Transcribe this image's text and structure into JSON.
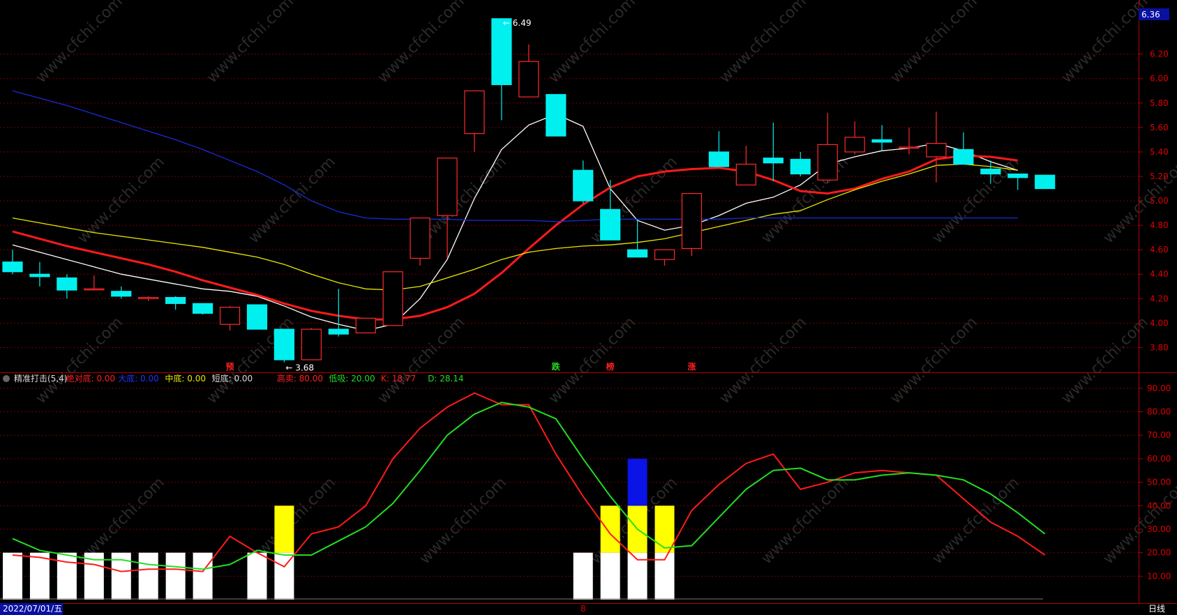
{
  "chart_data": [
    {
      "type": "candlestick",
      "name": "main",
      "ylim": [
        3.62,
        6.62
      ],
      "yticks": [
        "6.20",
        "6.00",
        "5.80",
        "5.60",
        "5.40",
        "5.20",
        "5.00",
        "4.80",
        "4.60",
        "4.40",
        "4.20",
        "4.00",
        "3.80"
      ],
      "top_value_label": "6.36",
      "max_marker": "6.49",
      "min_marker": "3.68",
      "candles": [
        {
          "o": 4.5,
          "h": 4.6,
          "l": 4.4,
          "c": 4.42
        },
        {
          "o": 4.4,
          "h": 4.5,
          "l": 4.3,
          "c": 4.38
        },
        {
          "o": 4.37,
          "h": 4.4,
          "l": 4.2,
          "c": 4.27
        },
        {
          "o": 4.28,
          "h": 4.39,
          "l": 4.27,
          "c": 4.28
        },
        {
          "o": 4.26,
          "h": 4.3,
          "l": 4.2,
          "c": 4.22
        },
        {
          "o": 4.2,
          "h": 4.22,
          "l": 4.18,
          "c": 4.21
        },
        {
          "o": 4.21,
          "h": 4.22,
          "l": 4.11,
          "c": 4.16
        },
        {
          "o": 4.16,
          "h": 4.16,
          "l": 4.07,
          "c": 4.08
        },
        {
          "o": 3.99,
          "h": 4.14,
          "l": 3.94,
          "c": 4.13
        },
        {
          "o": 4.15,
          "h": 4.15,
          "l": 3.95,
          "c": 3.95
        },
        {
          "o": 3.95,
          "h": 3.95,
          "l": 3.68,
          "c": 3.7
        },
        {
          "o": 3.7,
          "h": 3.96,
          "l": 3.7,
          "c": 3.95
        },
        {
          "o": 3.95,
          "h": 4.28,
          "l": 3.89,
          "c": 3.91
        },
        {
          "o": 3.92,
          "h": 4.04,
          "l": 3.92,
          "c": 4.04
        },
        {
          "o": 3.98,
          "h": 4.42,
          "l": 3.98,
          "c": 4.42
        },
        {
          "o": 4.53,
          "h": 4.86,
          "l": 4.47,
          "c": 4.86
        },
        {
          "o": 4.88,
          "h": 5.35,
          "l": 4.53,
          "c": 5.35
        },
        {
          "o": 5.55,
          "h": 5.9,
          "l": 5.4,
          "c": 5.9
        },
        {
          "o": 6.49,
          "h": 6.49,
          "l": 5.66,
          "c": 5.95
        },
        {
          "o": 5.85,
          "h": 6.28,
          "l": 5.85,
          "c": 6.14
        },
        {
          "o": 5.87,
          "h": 5.87,
          "l": 5.53,
          "c": 5.53
        },
        {
          "o": 5.25,
          "h": 5.33,
          "l": 4.98,
          "c": 5.0
        },
        {
          "o": 4.93,
          "h": 5.17,
          "l": 4.68,
          "c": 4.68
        },
        {
          "o": 4.6,
          "h": 4.85,
          "l": 4.55,
          "c": 4.54
        },
        {
          "o": 4.52,
          "h": 4.6,
          "l": 4.47,
          "c": 4.6
        },
        {
          "o": 4.61,
          "h": 5.06,
          "l": 4.55,
          "c": 5.06
        },
        {
          "o": 5.4,
          "h": 5.57,
          "l": 5.28,
          "c": 5.28
        },
        {
          "o": 5.13,
          "h": 5.45,
          "l": 5.13,
          "c": 5.3
        },
        {
          "o": 5.35,
          "h": 5.64,
          "l": 5.16,
          "c": 5.31
        },
        {
          "o": 5.34,
          "h": 5.4,
          "l": 5.2,
          "c": 5.22
        },
        {
          "o": 5.17,
          "h": 5.72,
          "l": 5.15,
          "c": 5.46
        },
        {
          "o": 5.4,
          "h": 5.65,
          "l": 5.38,
          "c": 5.52
        },
        {
          "o": 5.5,
          "h": 5.62,
          "l": 5.41,
          "c": 5.48
        },
        {
          "o": 5.44,
          "h": 5.6,
          "l": 5.38,
          "c": 5.44
        },
        {
          "o": 5.36,
          "h": 5.73,
          "l": 5.15,
          "c": 5.47
        },
        {
          "o": 5.42,
          "h": 5.56,
          "l": 5.32,
          "c": 5.3
        },
        {
          "o": 5.26,
          "h": 5.33,
          "l": 5.14,
          "c": 5.22
        },
        {
          "o": 5.22,
          "h": 5.22,
          "l": 5.09,
          "c": 5.19
        },
        {
          "o": 5.21,
          "h": 5.21,
          "l": 5.1,
          "c": 5.1
        }
      ],
      "series": [
        {
          "color": "#ffffff",
          "values": [
            4.64,
            4.58,
            4.52,
            4.46,
            4.4,
            4.36,
            4.32,
            4.28,
            4.26,
            4.22,
            4.14,
            4.05,
            3.99,
            3.94,
            3.99,
            4.2,
            4.52,
            5.02,
            5.42,
            5.62,
            5.71,
            5.61,
            5.1,
            4.84,
            4.76,
            4.8,
            4.88,
            4.98,
            5.03,
            5.13,
            5.3,
            5.36,
            5.41,
            5.43,
            5.47,
            5.41,
            5.32,
            5.25
          ]
        },
        {
          "color": "#ff1a1a",
          "values": [
            4.75,
            4.69,
            4.63,
            4.58,
            4.53,
            4.48,
            4.42,
            4.35,
            4.29,
            4.23,
            4.16,
            4.1,
            4.06,
            4.03,
            4.03,
            4.06,
            4.13,
            4.24,
            4.41,
            4.61,
            4.8,
            4.97,
            5.11,
            5.2,
            5.24,
            5.26,
            5.27,
            5.24,
            5.17,
            5.08,
            5.06,
            5.1,
            5.18,
            5.24,
            5.34,
            5.37,
            5.36,
            5.33
          ]
        },
        {
          "color": "#e8e800",
          "values": [
            4.86,
            4.82,
            4.78,
            4.74,
            4.71,
            4.68,
            4.65,
            4.62,
            4.58,
            4.54,
            4.48,
            4.4,
            4.33,
            4.28,
            4.27,
            4.3,
            4.37,
            4.44,
            4.52,
            4.58,
            4.61,
            4.63,
            4.64,
            4.66,
            4.69,
            4.74,
            4.79,
            4.84,
            4.89,
            4.92,
            5.01,
            5.09,
            5.16,
            5.22,
            5.29,
            5.3,
            5.28,
            5.25
          ]
        },
        {
          "color": "#1a2bd6",
          "values": [
            5.9,
            5.84,
            5.78,
            5.71,
            5.64,
            5.57,
            5.5,
            5.42,
            5.33,
            5.24,
            5.13,
            5.0,
            4.91,
            4.86,
            4.85,
            4.85,
            4.85,
            4.84,
            4.84,
            4.84,
            4.83,
            4.84,
            4.85,
            4.85,
            4.85,
            4.85,
            4.85,
            4.86,
            4.86,
            4.86,
            4.86,
            4.86,
            4.86,
            4.86,
            4.86,
            4.86,
            4.86,
            4.86
          ]
        }
      ],
      "markers": [
        {
          "index": 8,
          "label": "预",
          "color": "#ff2020"
        },
        {
          "index": 20,
          "label": "跌",
          "color": "#22dd22"
        },
        {
          "index": 22,
          "label": "榜",
          "color": "#ff2020"
        },
        {
          "index": 25,
          "label": "涨",
          "color": "#ff2020"
        }
      ]
    },
    {
      "type": "line",
      "name": "indicator",
      "ylim": [
        0,
        95
      ],
      "yticks": [
        "90.00",
        "80.00",
        "70.00",
        "60.00",
        "50.00",
        "40.00",
        "30.00",
        "20.00",
        "10.00"
      ],
      "legend": [
        {
          "text": "精准打击(5,4)",
          "color": "#dddddd"
        },
        {
          "text": "绝对底: 0.00",
          "color": "#ff2020"
        },
        {
          "text": "大底: 0.00",
          "color": "#2233ff"
        },
        {
          "text": "中底: 0.00",
          "color": "#e8e800"
        },
        {
          "text": "短底: 0.00",
          "color": "#dddddd"
        },
        {
          "text": "高卖: 80.00",
          "color": "#ff2020"
        },
        {
          "text": "低吸: 20.00",
          "color": "#22dd22"
        },
        {
          "text": "K: 18.77",
          "color": "#ff2020"
        },
        {
          "text": "D: 28.14",
          "color": "#22dd22"
        }
      ],
      "K": [
        19,
        18,
        16,
        15,
        12,
        13,
        13,
        12,
        27,
        20,
        14,
        28,
        31,
        40,
        60,
        73,
        82,
        88,
        83,
        83,
        62,
        44,
        28,
        17,
        17,
        38,
        49,
        58,
        62,
        47,
        50,
        54,
        55,
        54,
        53,
        43,
        33,
        27,
        19
      ],
      "D": [
        26,
        21,
        19,
        17,
        17,
        15,
        14,
        13,
        15,
        21,
        19,
        19,
        25,
        31,
        41,
        55,
        70,
        79,
        84,
        82,
        77,
        60,
        44,
        30,
        22,
        23,
        35,
        47,
        55,
        56,
        51,
        51,
        53,
        54,
        53,
        51,
        45,
        37,
        28
      ],
      "white_bars": [
        0,
        1,
        2,
        3,
        4,
        5,
        6,
        7,
        9,
        10,
        21,
        22,
        23,
        24
      ],
      "yellow_bars": [
        {
          "index": 10,
          "top": 40
        },
        {
          "index": 22,
          "top": 40
        },
        {
          "index": 23,
          "top": 40
        },
        {
          "index": 24,
          "top": 40
        }
      ],
      "blue_bars": [
        {
          "index": 23,
          "top": 60
        }
      ]
    }
  ],
  "date_label": "2022/07/01/五",
  "period_label": "日线",
  "axis_marker": "8",
  "watermark": "www.cfchi.com"
}
